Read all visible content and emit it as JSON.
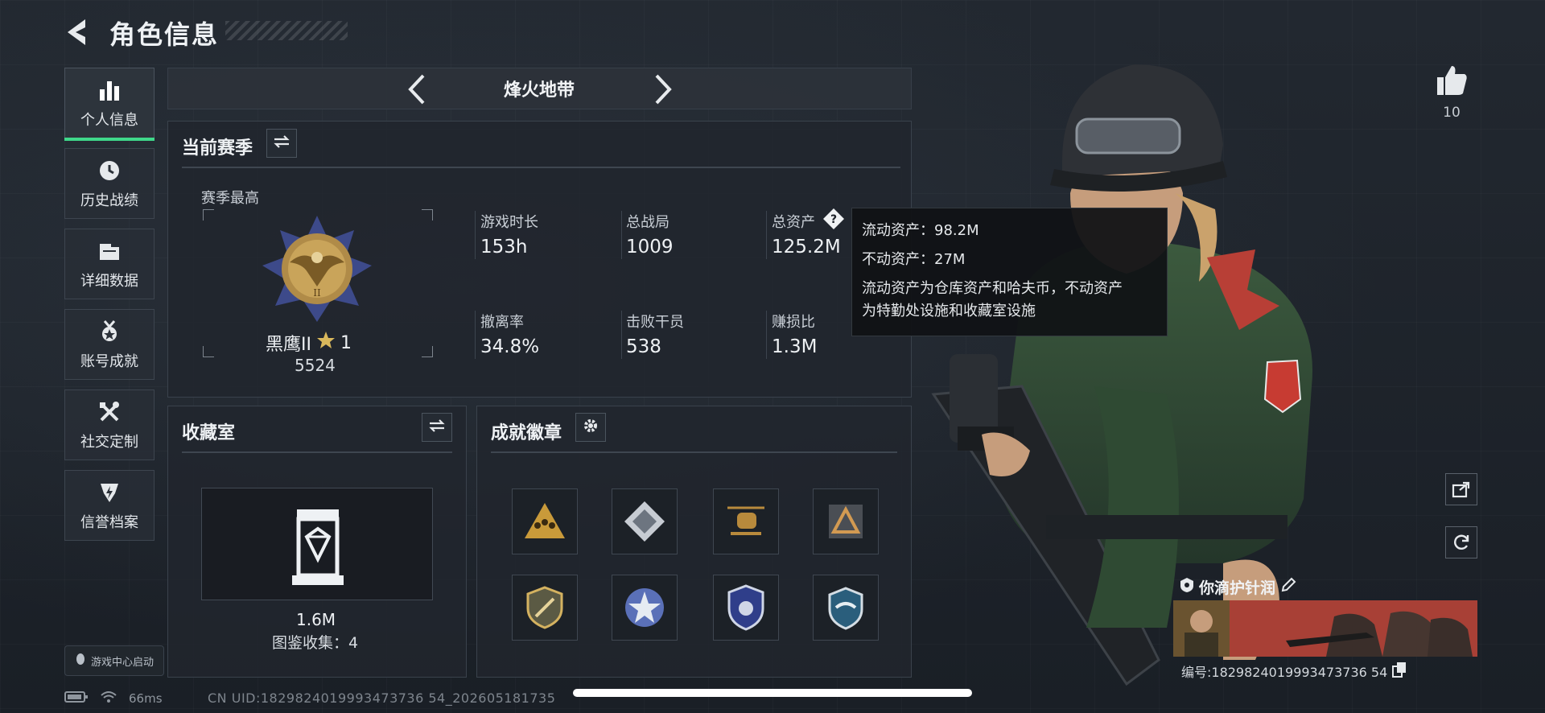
{
  "header": {
    "title": "角色信息"
  },
  "nav": {
    "items": [
      {
        "label": "个人信息",
        "icon": "bar-chart-icon",
        "active": true
      },
      {
        "label": "历史战绩",
        "icon": "history-clock-icon",
        "active": false
      },
      {
        "label": "详细数据",
        "icon": "folder-icon",
        "active": false
      },
      {
        "label": "账号成就",
        "icon": "medal-icon",
        "active": false
      },
      {
        "label": "社交定制",
        "icon": "tools-icon",
        "active": false
      },
      {
        "label": "信誉档案",
        "icon": "credit-shield-icon",
        "active": false
      }
    ],
    "launch_label": "游戏中心启动"
  },
  "mode": {
    "title": "烽火地带"
  },
  "season": {
    "title": "当前赛季",
    "best_label": "赛季最高",
    "rank_name": "黑鹰II",
    "rank_stars": "1",
    "rank_score": "5524",
    "stats": [
      {
        "label": "游戏时长",
        "value": "153h"
      },
      {
        "label": "总战局",
        "value": "1009"
      },
      {
        "label": "总资产",
        "value": "125.2M"
      },
      {
        "label": "撤离率",
        "value": "34.8%"
      },
      {
        "label": "击败干员",
        "value": "538"
      },
      {
        "label": "赚损比",
        "value": "1.3M"
      }
    ]
  },
  "tooltip": {
    "liquid": "流动资产：98.2M",
    "fixed": "不动资产：27M",
    "description_1": "流动资产为仓库资产和哈夫币，不动资产",
    "description_2": "为特勤处设施和收藏室设施"
  },
  "collection": {
    "title": "收藏室",
    "value": "1.6M",
    "catalog": "图鉴收集：4"
  },
  "achievements": {
    "title": "成就徽章",
    "badges": [
      "badge-triangle-squad",
      "badge-diamond-map",
      "badge-helicopter",
      "badge-triangle-emblem",
      "badge-knife-shield",
      "badge-star-circle",
      "badge-eagle-shield",
      "badge-wings-shield"
    ]
  },
  "social": {
    "like_count": "10"
  },
  "player": {
    "name": "你滴护针润",
    "uid": "编号:1829824019993473736 54"
  },
  "status": {
    "ping": "66ms",
    "cn_uid": "CN UID:1829824019993473736 54_202605181735"
  },
  "colors": {
    "accent": "#3fd88a",
    "panel": "#21262d",
    "banner": "#9a3b35"
  }
}
